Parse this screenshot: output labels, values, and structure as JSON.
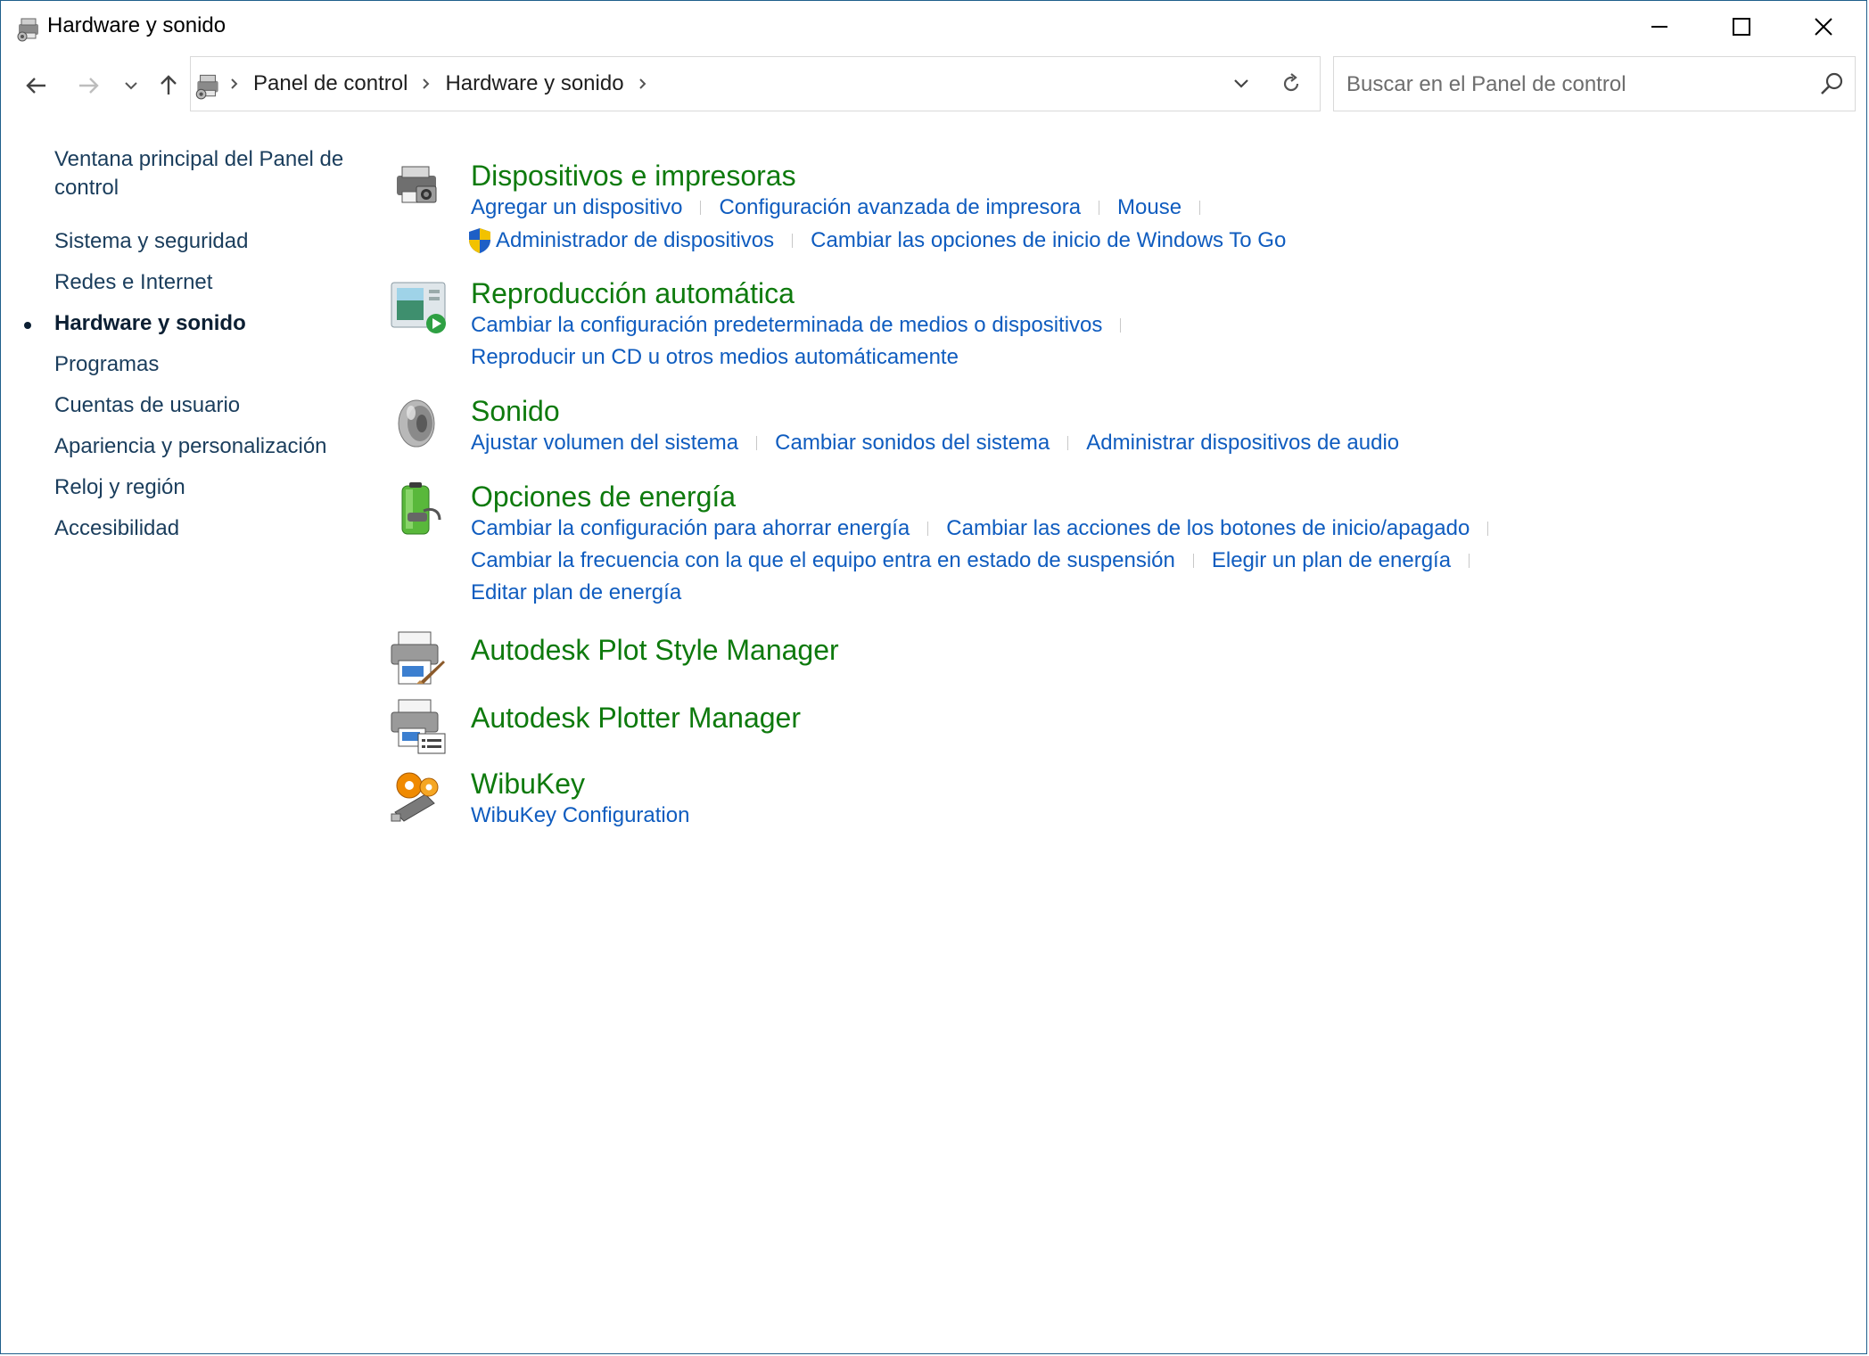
{
  "window": {
    "title": "Hardware y sonido"
  },
  "address": {
    "crumbs": [
      "Panel de control",
      "Hardware y sonido"
    ]
  },
  "search": {
    "placeholder": "Buscar en el Panel de control"
  },
  "sidebar": {
    "items": [
      {
        "label": "Ventana principal del Panel de control"
      },
      {
        "label": "Sistema y seguridad"
      },
      {
        "label": "Redes e Internet"
      },
      {
        "label": "Hardware y sonido",
        "active": true
      },
      {
        "label": "Programas"
      },
      {
        "label": "Cuentas de usuario"
      },
      {
        "label": "Apariencia y personalización"
      },
      {
        "label": "Reloj y región"
      },
      {
        "label": "Accesibilidad"
      }
    ]
  },
  "categories": [
    {
      "title": "Dispositivos e impresoras",
      "icon": "devices-printers-icon",
      "links": [
        [
          "Agregar un dispositivo",
          "Configuración avanzada de impresora",
          "Mouse"
        ],
        [
          "Administrador de dispositivos",
          "Cambiar las opciones de inicio de Windows To Go"
        ]
      ]
    },
    {
      "title": "Reproducción automática",
      "icon": "autoplay-icon",
      "links": [
        [
          "Cambiar la configuración predeterminada de medios o dispositivos"
        ],
        [
          "Reproducir un CD u otros medios automáticamente"
        ]
      ]
    },
    {
      "title": "Sonido",
      "icon": "speaker-icon",
      "links": [
        [
          "Ajustar volumen del sistema",
          "Cambiar sonidos del sistema",
          "Administrar dispositivos de audio"
        ]
      ]
    },
    {
      "title": "Opciones de energía",
      "icon": "battery-power-icon",
      "links": [
        [
          "Cambiar la configuración para ahorrar energía",
          "Cambiar las acciones de los botones de inicio/apagado"
        ],
        [
          "Cambiar la frecuencia con la que el equipo entra en estado de suspensión",
          "Elegir un plan de energía"
        ],
        [
          "Editar plan de energía"
        ]
      ]
    },
    {
      "title": "Autodesk Plot Style Manager",
      "icon": "plot-style-printer-icon",
      "links": []
    },
    {
      "title": "Autodesk Plotter Manager",
      "icon": "plotter-manager-icon",
      "links": []
    },
    {
      "title": "WibuKey",
      "icon": "wibukey-gears-icon",
      "links": [
        [
          "WibuKey Configuration"
        ]
      ]
    }
  ],
  "colors": {
    "category_title": "#0e7a0d",
    "link": "#0f5cbf",
    "nav_text": "#1a3d5c",
    "border": "#1f5f8b"
  }
}
